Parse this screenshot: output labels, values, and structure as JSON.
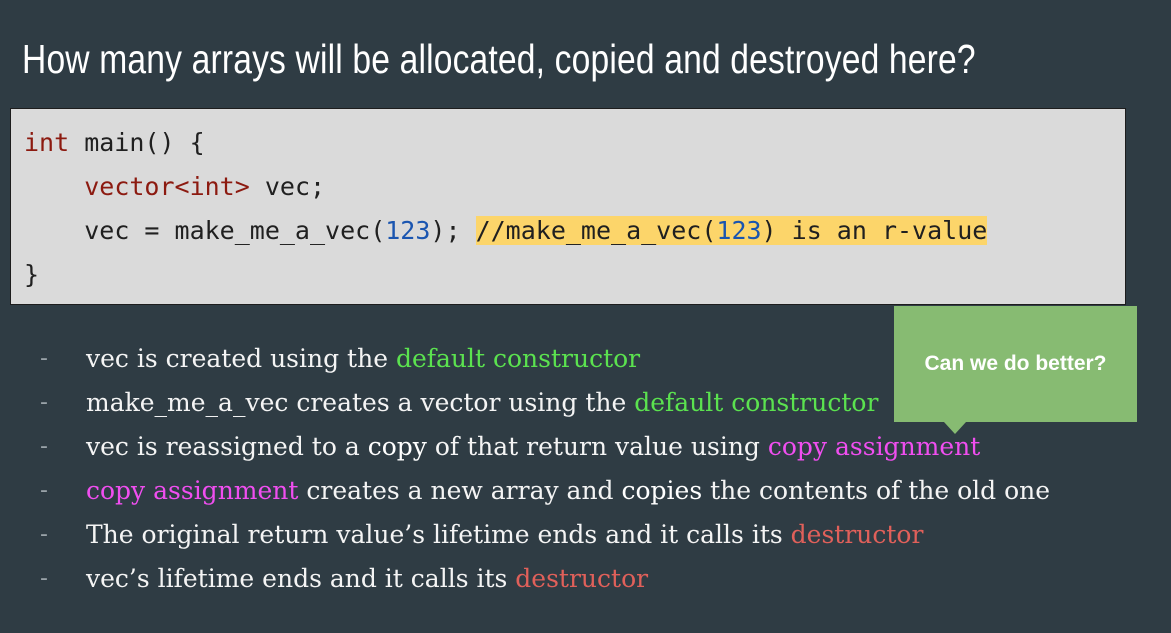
{
  "title": "How many arrays will be allocated, copied and destroyed here?",
  "code": {
    "line1": {
      "kw": "int",
      "rest": " main() {"
    },
    "line2": {
      "indent": "    ",
      "kw1": "vector<",
      "kw2": "int",
      "kw3": ">",
      "rest": " vec;"
    },
    "line3": {
      "indent": "    ",
      "pre": "vec = make_me_a_vec(",
      "num": "123",
      "post": "); ",
      "c1": "//make_me_a_vec(",
      "cnum": "123",
      "c2": ") is an r-value"
    },
    "line4": "}"
  },
  "bullets": [
    {
      "t1": "vec is created using the ",
      "h1": "default constructor"
    },
    {
      "t1": "make_me_a_vec creates a vector using the ",
      "h1": "default constructor"
    },
    {
      "t1": "vec is reassigned to a ",
      "s1": "copy",
      "t2": " of that return value using ",
      "h1": "copy assignment"
    },
    {
      "h1": "copy assignment",
      "t1": " creates a new array and ",
      "s1": "copies",
      "t2": " the contents of the old one"
    },
    {
      "t1": "The original return value’s lifetime ends and it calls its ",
      "h1": "destructor"
    },
    {
      "t1": "vec’s lifetime ends and it calls its ",
      "h1": "destructor"
    }
  ],
  "dash": "-",
  "callout": "Can we do better?",
  "colors": {
    "background": "#2f3c44",
    "code_bg": "#dadada",
    "highlight": "#fcd56a",
    "green": "#5be24f",
    "magenta": "#f04ef0",
    "red": "#e0605a",
    "callout_bg": "#87bb72"
  }
}
